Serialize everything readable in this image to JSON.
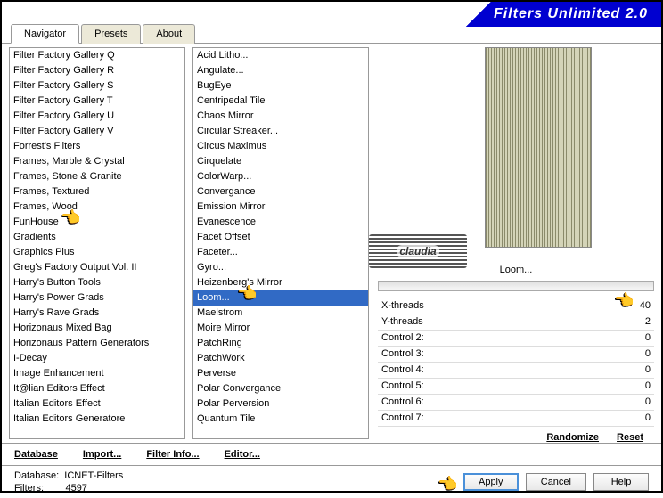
{
  "header": {
    "title": "Filters Unlimited 2.0"
  },
  "tabs": [
    {
      "label": "Navigator",
      "active": true
    },
    {
      "label": "Presets",
      "active": false
    },
    {
      "label": "About",
      "active": false
    }
  ],
  "categories": [
    "Filter Factory Gallery Q",
    "Filter Factory Gallery R",
    "Filter Factory Gallery S",
    "Filter Factory Gallery T",
    "Filter Factory Gallery U",
    "Filter Factory Gallery V",
    "Forrest's Filters",
    "Frames, Marble & Crystal",
    "Frames, Stone & Granite",
    "Frames, Textured",
    "Frames, Wood",
    "FunHouse",
    "Gradients",
    "Graphics Plus",
    "Greg's Factory Output Vol. II",
    "Harry's Button Tools",
    "Harry's Power Grads",
    "Harry's Rave Grads",
    "Horizonaus Mixed Bag",
    "Horizonaus Pattern Generators",
    "I-Decay",
    "Image Enhancement",
    "It@lian Editors Effect",
    "Italian Editors Effect",
    "Italian Editors Generatore",
    "",
    "",
    ""
  ],
  "filters": [
    "Acid Litho...",
    "Angulate...",
    "BugEye",
    "Centripedal Tile",
    "Chaos Mirror",
    "Circular Streaker...",
    "Circus Maximus",
    "Cirquelate",
    "ColorWarp...",
    "Convergance",
    "Emission Mirror",
    "Evanescence",
    "Facet Offset",
    "Faceter...",
    "Gyro...",
    "Heizenberg's Mirror",
    "Loom...",
    "Maelstrom",
    "Moire Mirror",
    "PatchRing",
    "PatchWork",
    "Perverse",
    "Polar Convergance",
    "Polar Perversion",
    "Quantum Tile",
    "",
    "",
    ""
  ],
  "selected_filter_index": 16,
  "filter_name": "Loom...",
  "watermark": "claudia",
  "params": [
    {
      "name": "X-threads",
      "value": 40
    },
    {
      "name": "Y-threads",
      "value": 2
    },
    {
      "name": "Control 2:",
      "value": 0
    },
    {
      "name": "Control 3:",
      "value": 0
    },
    {
      "name": "Control 4:",
      "value": 0
    },
    {
      "name": "Control 5:",
      "value": 0
    },
    {
      "name": "Control 6:",
      "value": 0
    },
    {
      "name": "Control 7:",
      "value": 0
    }
  ],
  "bottom_links": {
    "database": "Database",
    "import": "Import...",
    "filter_info": "Filter Info...",
    "editor": "Editor...",
    "randomize": "Randomize",
    "reset": "Reset"
  },
  "footer": {
    "db_label": "Database:",
    "db_value": "ICNET-Filters",
    "filters_label": "Filters:",
    "filters_value": "4597"
  },
  "buttons": {
    "apply": "Apply",
    "cancel": "Cancel",
    "help": "Help"
  }
}
